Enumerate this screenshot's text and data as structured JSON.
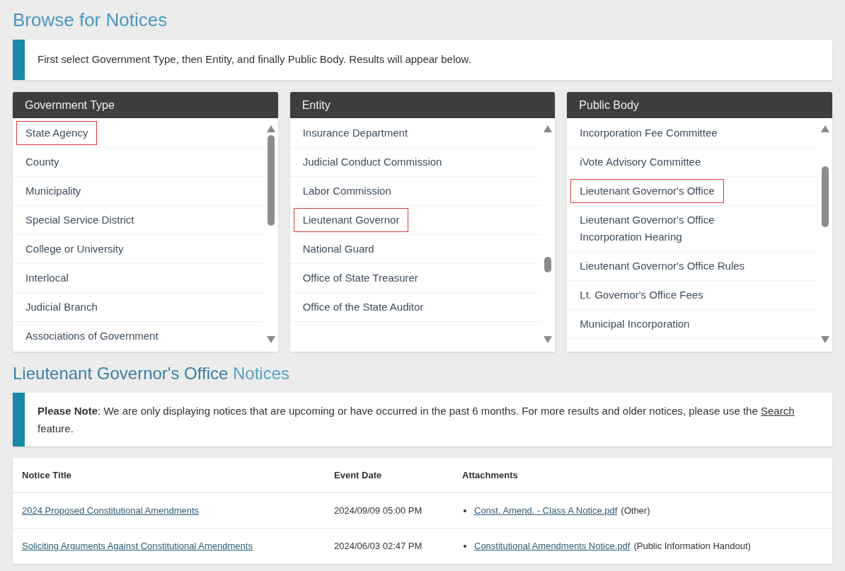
{
  "page_title": "Browse for Notices",
  "instructions": "First select Government Type, then Entity, and finally Public Body. Results will appear below.",
  "panels": [
    {
      "title": "Government Type",
      "items": [
        {
          "label": "State Agency",
          "selected": true
        },
        {
          "label": "County",
          "selected": false
        },
        {
          "label": "Municipality",
          "selected": false
        },
        {
          "label": "Special Service District",
          "selected": false
        },
        {
          "label": "College or University",
          "selected": false
        },
        {
          "label": "Interlocal",
          "selected": false
        },
        {
          "label": "Judicial Branch",
          "selected": false
        },
        {
          "label": "Associations of Government",
          "selected": false
        }
      ]
    },
    {
      "title": "Entity",
      "items": [
        {
          "label": "Insurance Department",
          "selected": false
        },
        {
          "label": "Judicial Conduct Commission",
          "selected": false
        },
        {
          "label": "Labor Commission",
          "selected": false
        },
        {
          "label": "Lieutenant Governor",
          "selected": true
        },
        {
          "label": "National Guard",
          "selected": false
        },
        {
          "label": "Office of State Treasurer",
          "selected": false
        },
        {
          "label": "Office of the State Auditor",
          "selected": false
        }
      ]
    },
    {
      "title": "Public Body",
      "items": [
        {
          "label": "Incorporation Fee Committee",
          "selected": false
        },
        {
          "label": "iVote Advisory Committee",
          "selected": false
        },
        {
          "label": "Lieutenant Governor's Office",
          "selected": true
        },
        {
          "label": "Lieutenant Governor's Office Incorporation Hearing",
          "selected": false
        },
        {
          "label": "Lieutenant Governor's Office Rules",
          "selected": false
        },
        {
          "label": "Lt. Governor's Office Fees",
          "selected": false
        },
        {
          "label": "Municipal Incorporation",
          "selected": false
        }
      ]
    }
  ],
  "results_heading": {
    "entity": "Lieutenant Governor's Office",
    "suffix": "Notices"
  },
  "note": {
    "before": "**Please Note**: We are only displaying notices that are upcoming or have occurred in the past 6 months. For more results and older notices, please use the",
    "link": "Search",
    "after": "feature."
  },
  "table": {
    "columns": [
      "Notice Title",
      "Event Date",
      "Attachments"
    ],
    "rows": [
      {
        "title": "2024 Proposed Constitutional Amendments",
        "date": "2024/09/09 05:00 PM",
        "attachment": "Const. Amend. - Class A Notice.pdf",
        "attachment_type": "(Other)"
      },
      {
        "title": "Soliciting Arguments Against Constitutional Amendments",
        "date": "2024/06/03 02:47 PM",
        "attachment": "Constitutional Amendments Notice.pdf",
        "attachment_type": "(Public Information Handout)"
      }
    ]
  }
}
